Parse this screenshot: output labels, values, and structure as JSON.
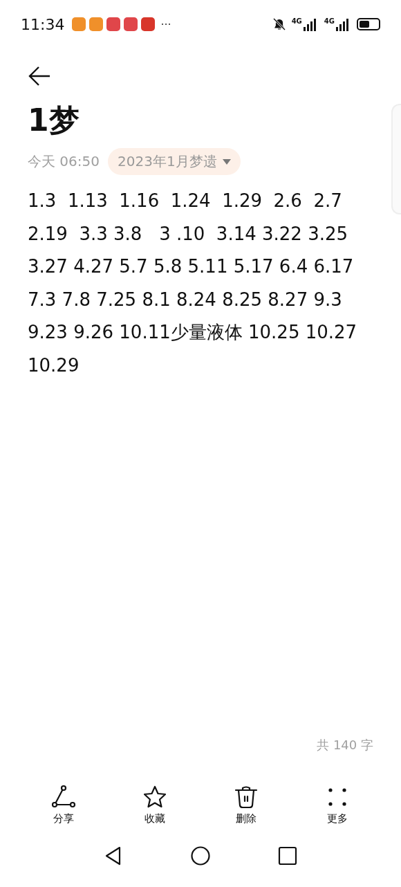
{
  "status_bar": {
    "time": "11:34",
    "notification_icons": [
      {
        "color": "#f0902a"
      },
      {
        "color": "#f0902a"
      },
      {
        "color": "#e0464a"
      },
      {
        "color": "#e0464a"
      },
      {
        "color": "#d8362a"
      }
    ],
    "overflow": "···",
    "signals": [
      {
        "label": "4G"
      },
      {
        "label": "4G"
      }
    ]
  },
  "note": {
    "title": "1梦",
    "time": "今天 06:50",
    "notebook": "2023年1月梦遗",
    "lines": [
      "1.3  1.13  1.16  1.24  1.29  2.6  2.7",
      "2.19  3.3 3.8   3 .10  3.14 3.22 3.25",
      "3.27 4.27 5.7 5.8 5.11 5.17 6.4 6.17",
      "7.3 7.8 7.25 8.1 8.24 8.25 8.27 9.3",
      "9.23 9.26 10.11少量液体 10.25 10.27",
      "10.29"
    ],
    "word_count": "共 140 字"
  },
  "toolbar": [
    {
      "kind": "share",
      "label": "分享"
    },
    {
      "kind": "star",
      "label": "收藏"
    },
    {
      "kind": "trash",
      "label": "删除"
    },
    {
      "kind": "more",
      "label": "更多"
    }
  ]
}
